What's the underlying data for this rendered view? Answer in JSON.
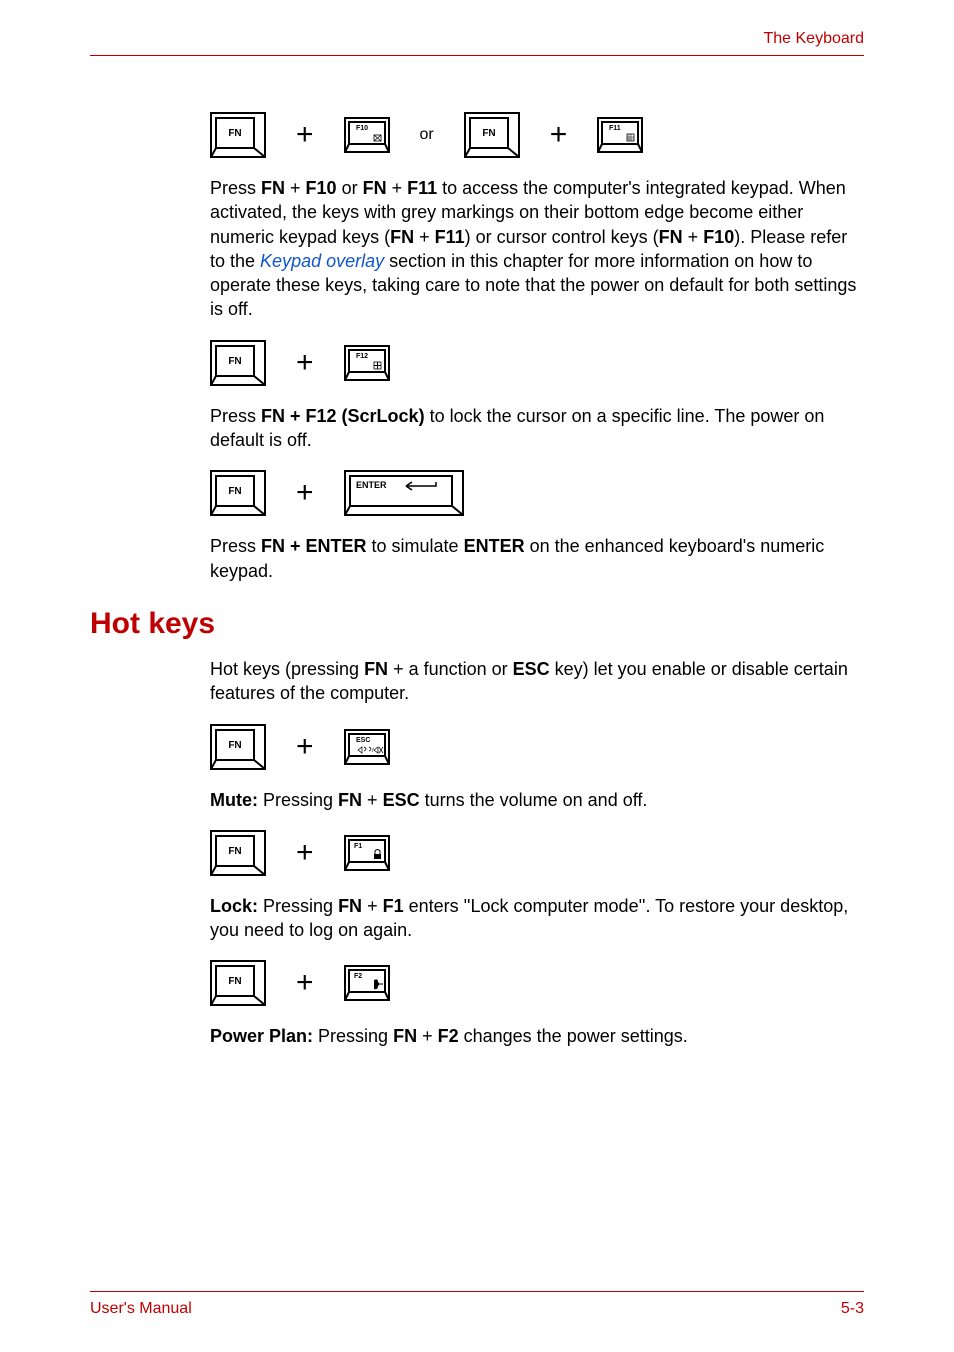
{
  "header": {
    "chapter_title": "The Keyboard"
  },
  "rows": {
    "row1": {
      "k1": "FN",
      "k2": "F10",
      "or": "or",
      "k3": "FN",
      "k4": "F11"
    },
    "row2": {
      "k1": "FN",
      "k2": "F12"
    },
    "row3": {
      "k1": "FN",
      "k2": "ENTER"
    },
    "row4": {
      "k1": "FN",
      "k2": "ESC"
    },
    "row5": {
      "k1": "FN",
      "k2": "F1"
    },
    "row6": {
      "k1": "FN",
      "k2": "F2"
    }
  },
  "paragraphs": {
    "p1_a": "Press ",
    "p1_b": "FN",
    "p1_c": " + ",
    "p1_d": "F10",
    "p1_e": " or ",
    "p1_f": "FN",
    "p1_g": " + ",
    "p1_h": "F11",
    "p1_i": " to access the computer's integrated keypad. When activated, the keys with grey markings on their bottom edge become either numeric keypad keys (",
    "p1_j": "FN",
    "p1_k": " + ",
    "p1_l": "F11",
    "p1_m": ") or cursor control keys (",
    "p1_n": "FN",
    "p1_o": " + ",
    "p1_p": "F10",
    "p1_q": "). Please refer to the ",
    "p1_link": "Keypad overlay",
    "p1_r": " section in this chapter for more information on how to operate these keys, taking care to note that the power on default for both settings is off.",
    "p2_a": "Press ",
    "p2_b": "FN + F12 (ScrLock)",
    "p2_c": " to lock the cursor on a specific line. The power on default is off.",
    "p3_a": "Press ",
    "p3_b": "FN + ENTER",
    "p3_c": " to simulate ",
    "p3_d": "ENTER",
    "p3_e": " on the enhanced keyboard's numeric keypad.",
    "hotkeys_heading": "Hot keys",
    "p4_a": "Hot keys (pressing ",
    "p4_b": "FN",
    "p4_c": " + a function or ",
    "p4_d": "ESC",
    "p4_e": " key) let you enable or disable certain features of the computer.",
    "p5_a": "Mute:",
    "p5_b": " Pressing ",
    "p5_c": "FN",
    "p5_d": " + ",
    "p5_e": "ESC",
    "p5_f": " turns the volume on and off.",
    "p6_a": "Lock:",
    "p6_b": " Pressing ",
    "p6_c": "FN",
    "p6_d": " + ",
    "p6_e": "F1",
    "p6_f": " enters ''Lock computer mode''. To restore your desktop, you need to log on again.",
    "p7_a": "Power Plan:",
    "p7_b": " Pressing ",
    "p7_c": "FN",
    "p7_d": " + ",
    "p7_e": "F2",
    "p7_f": " changes the power settings."
  },
  "footer": {
    "left": "User's Manual",
    "right": "5-3"
  }
}
